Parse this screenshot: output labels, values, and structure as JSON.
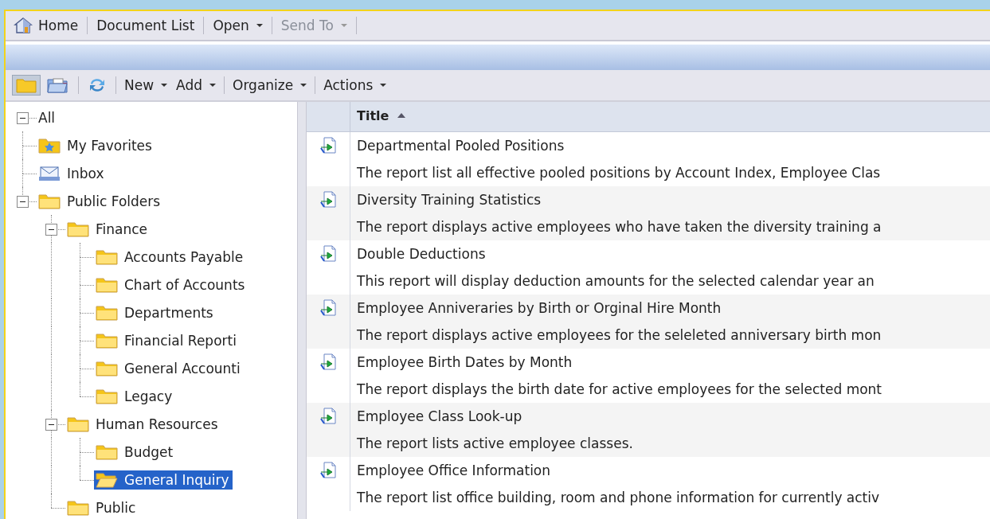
{
  "nav_bar": {
    "items": [
      {
        "label": "Home",
        "kind": "home",
        "dropdown": false,
        "disabled": false
      },
      {
        "label": "Document List",
        "kind": "plain",
        "dropdown": false,
        "disabled": false
      },
      {
        "label": "Open",
        "kind": "plain",
        "dropdown": true,
        "disabled": false
      },
      {
        "label": "Send To",
        "kind": "plain",
        "dropdown": true,
        "disabled": true
      }
    ]
  },
  "toolbar": {
    "view_buttons": [
      {
        "kind": "folders",
        "selected": true
      },
      {
        "kind": "categories",
        "selected": false
      }
    ],
    "menu_groups": [
      {
        "menus": [
          {
            "label": "New"
          },
          {
            "label": "Add"
          }
        ]
      },
      {
        "menus": [
          {
            "label": "Organize"
          }
        ]
      },
      {
        "menus": [
          {
            "label": "Actions"
          }
        ]
      }
    ]
  },
  "tree": [
    {
      "label": "All",
      "expanded": true,
      "selected": false,
      "children": [
        {
          "label": "My Favorites",
          "kind": "favorites",
          "selected": false
        },
        {
          "label": "Inbox",
          "kind": "inbox",
          "selected": false
        },
        {
          "label": "Public Folders",
          "kind": "folder",
          "expanded": true,
          "selected": false,
          "children": [
            {
              "label": "Finance",
              "kind": "folder",
              "expanded": true,
              "selected": false,
              "children": [
                {
                  "label": "Accounts Payable",
                  "kind": "folder",
                  "selected": false
                },
                {
                  "label": "Chart of Accounts",
                  "kind": "folder",
                  "selected": false
                },
                {
                  "label": "Departments",
                  "kind": "folder",
                  "selected": false
                },
                {
                  "label": "Financial Reporti",
                  "kind": "folder",
                  "selected": false
                },
                {
                  "label": "General Accounti",
                  "kind": "folder",
                  "selected": false
                },
                {
                  "label": "Legacy",
                  "kind": "folder",
                  "selected": false
                }
              ]
            },
            {
              "label": "Human Resources",
              "kind": "folder",
              "expanded": true,
              "selected": false,
              "children": [
                {
                  "label": "Budget",
                  "kind": "folder",
                  "selected": false
                },
                {
                  "label": "General Inquiry",
                  "kind": "folder",
                  "selected": true
                }
              ]
            },
            {
              "label": "Public",
              "kind": "folder",
              "selected": false
            }
          ]
        }
      ]
    }
  ],
  "list": {
    "columns": [
      {
        "label": "Title",
        "sort_ascending": true
      }
    ],
    "rows": [
      {
        "title": "Departmental Pooled Positions",
        "description": "The report list all effective pooled positions by Account Index, Employee Clas"
      },
      {
        "title": "Diversity Training Statistics",
        "description": "The report displays active employees who have taken the diversity training a"
      },
      {
        "title": "Double Deductions",
        "description": "This report will display deduction amounts for the selected calendar year an"
      },
      {
        "title": "Employee Anniveraries by Birth or Orginal Hire Month",
        "description": "The report displays active employees for the seleleted anniversary birth mon"
      },
      {
        "title": "Employee Birth Dates by Month",
        "description": "The report displays the birth date for active employees for the selected mont"
      },
      {
        "title": "Employee Class Look-up",
        "description": "The report lists active employee classes."
      },
      {
        "title": "Employee Office Information",
        "description": "The report list office building, room and phone information for currently activ"
      }
    ]
  }
}
